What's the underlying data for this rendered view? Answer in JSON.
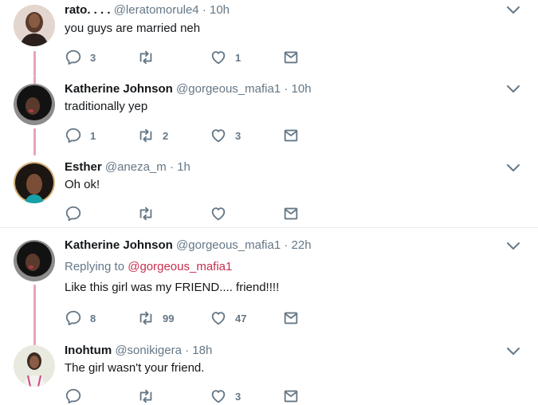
{
  "tweets": [
    {
      "name": "rato. . . .",
      "handle": "@leratomorule4",
      "time": "· 10h",
      "text": "you guys are married neh",
      "replies": "3",
      "retweets": "",
      "likes": "1"
    },
    {
      "name": "Katherine Johnson",
      "handle": "@gorgeous_mafia1",
      "time": "· 10h",
      "text": "traditionally yep",
      "replies": "1",
      "retweets": "2",
      "likes": "3"
    },
    {
      "name": "Esther",
      "handle": "@aneza_m",
      "time": "· 1h",
      "text": "Oh ok!",
      "replies": "",
      "retweets": "",
      "likes": ""
    },
    {
      "name": "Katherine Johnson",
      "handle": "@gorgeous_mafia1",
      "time": "· 22h",
      "replying_prefix": "Replying to",
      "replying_handle": "@gorgeous_mafia1",
      "text": "Like this girl was my FRIEND.... friend!!!!",
      "replies": "8",
      "retweets": "99",
      "likes": "47"
    },
    {
      "name": "Inohtum",
      "handle": "@sonikigera",
      "time": "· 18h",
      "text": "The girl wasn't your friend.",
      "replies": "",
      "retweets": "",
      "likes": "3"
    }
  ],
  "colors": {
    "thread_line": "#e8a4b8",
    "icon_gray": "#657786",
    "reply_link": "#c7304f"
  }
}
